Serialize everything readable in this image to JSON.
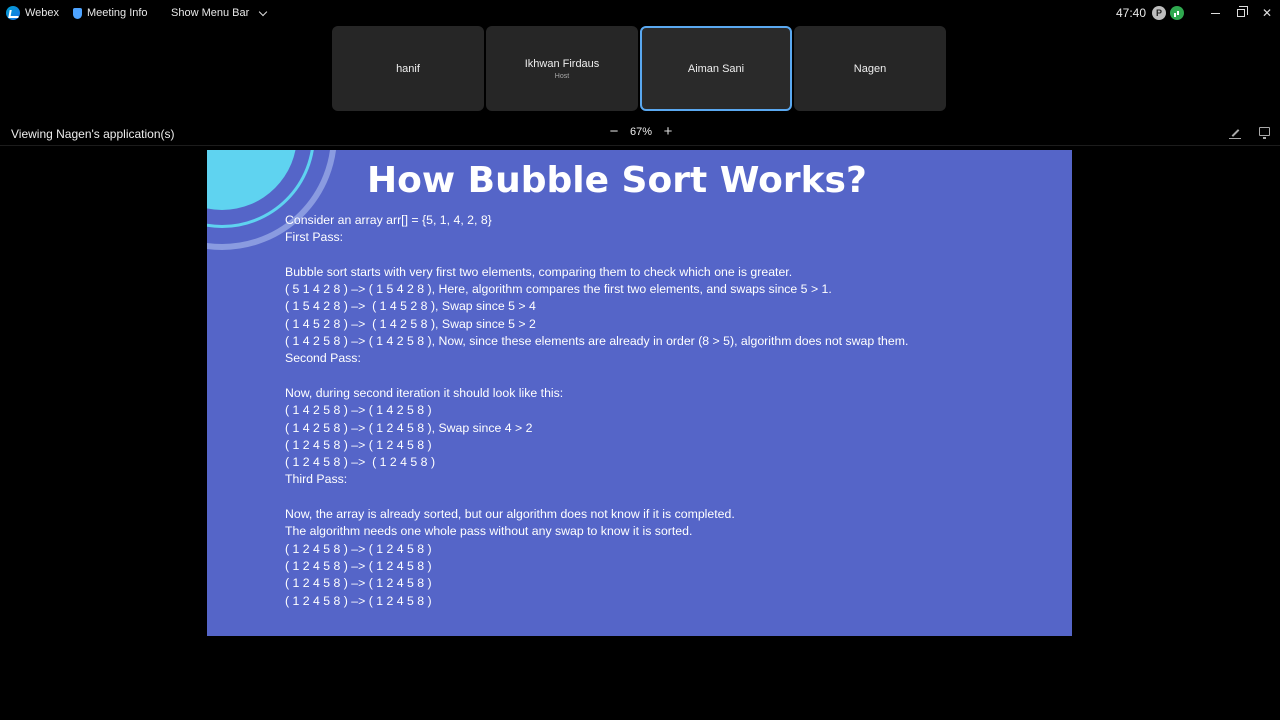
{
  "titlebar": {
    "app_name": "Webex",
    "meeting_info": "Meeting Info",
    "show_menu_bar": "Show Menu Bar",
    "timer": "47:40",
    "rec_badge": "P"
  },
  "participants": [
    {
      "name": "hanif",
      "role": ""
    },
    {
      "name": "Ikhwan Firdaus",
      "role": "Host"
    },
    {
      "name": "Aiman Sani",
      "role": ""
    },
    {
      "name": "Nagen",
      "role": ""
    }
  ],
  "share": {
    "viewing": "Viewing Nagen's application(s)",
    "zoom": "67%",
    "zoom_out": "−",
    "zoom_in": "+"
  },
  "slide": {
    "title": "How Bubble Sort Works?",
    "lines": [
      "Consider an array arr[] = {5, 1, 4, 2, 8}",
      "First Pass:",
      "",
      "Bubble sort starts with very first two elements, comparing them to check which one is greater.",
      "( 5 1 4 2 8 ) –> ( 1 5 4 2 8 ), Here, algorithm compares the first two elements, and swaps since 5 > 1.",
      "( 1 5 4 2 8 ) –>  ( 1 4 5 2 8 ), Swap since 5 > 4",
      "( 1 4 5 2 8 ) –>  ( 1 4 2 5 8 ), Swap since 5 > 2",
      "( 1 4 2 5 8 ) –> ( 1 4 2 5 8 ), Now, since these elements are already in order (8 > 5), algorithm does not swap them.",
      "Second Pass:",
      "",
      "Now, during second iteration it should look like this:",
      "( 1 4 2 5 8 ) –> ( 1 4 2 5 8 )",
      "( 1 4 2 5 8 ) –> ( 1 2 4 5 8 ), Swap since 4 > 2",
      "( 1 2 4 5 8 ) –> ( 1 2 4 5 8 )",
      "( 1 2 4 5 8 ) –>  ( 1 2 4 5 8 )",
      "Third Pass:",
      "",
      "Now, the array is already sorted, but our algorithm does not know if it is completed.",
      "The algorithm needs one whole pass without any swap to know it is sorted.",
      "( 1 2 4 5 8 ) –> ( 1 2 4 5 8 )",
      "( 1 2 4 5 8 ) –> ( 1 2 4 5 8 )",
      "( 1 2 4 5 8 ) –> ( 1 2 4 5 8 )",
      "( 1 2 4 5 8 ) –> ( 1 2 4 5 8 )"
    ]
  },
  "colors": {
    "slide_bg": "#5565c8",
    "accent_cyan": "#5fd3f0",
    "active_tile_border": "#5aa8f0"
  }
}
